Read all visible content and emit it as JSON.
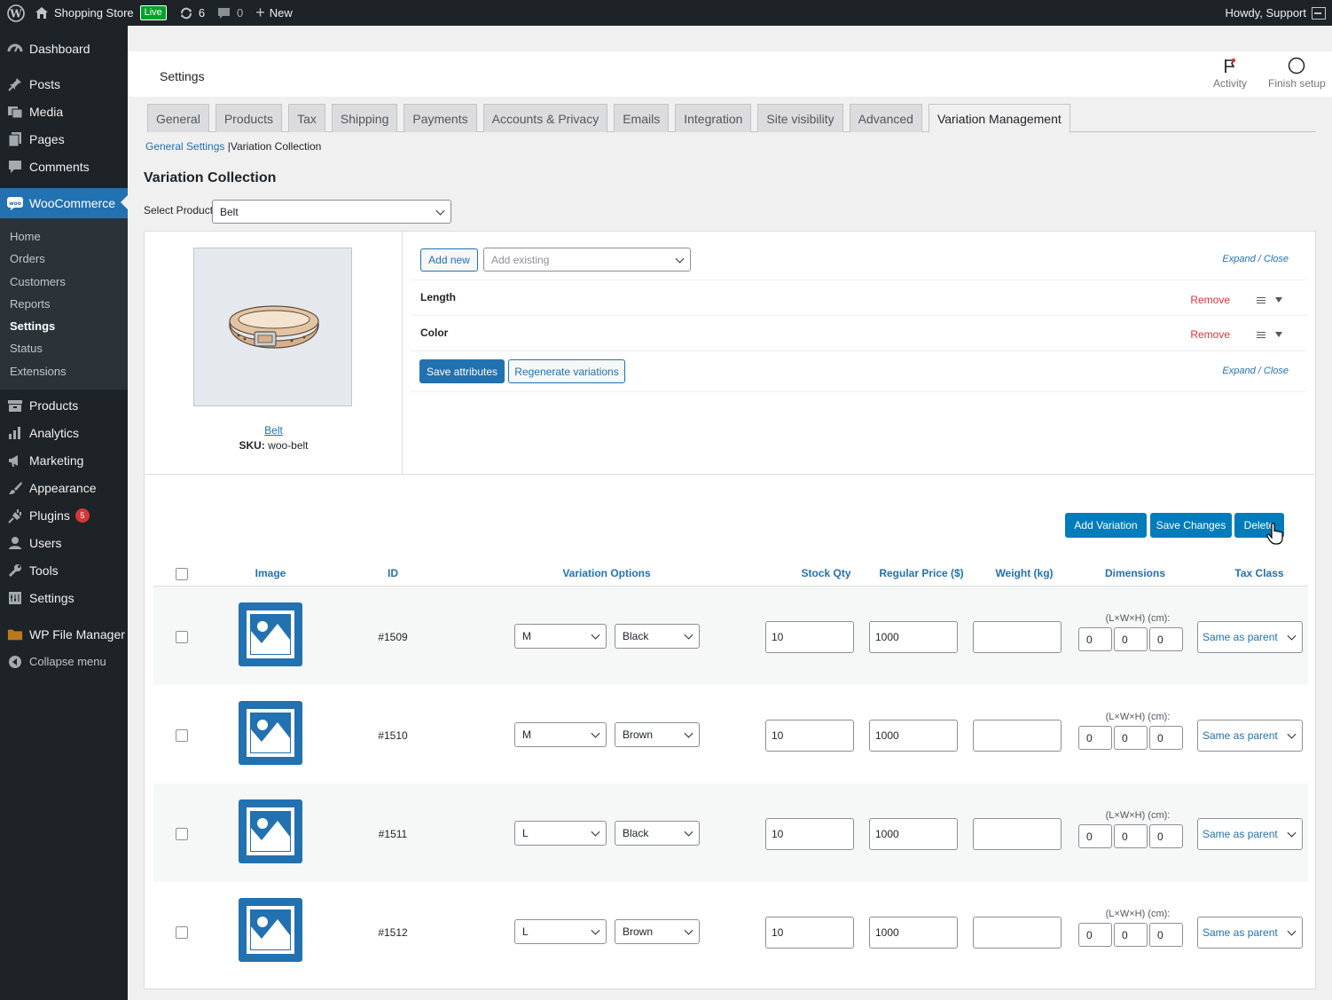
{
  "adminbar": {
    "site_name": "Shopping Store",
    "live_badge": "Live",
    "updates_count": "6",
    "comments_count": "0",
    "new_label": "New",
    "howdy": "Howdy, Support"
  },
  "sidebar": {
    "items_top": [
      {
        "label": "Dashboard",
        "icon": "dashboard-icon"
      },
      {
        "label": "Posts",
        "icon": "pin-icon"
      },
      {
        "label": "Media",
        "icon": "media-icon"
      },
      {
        "label": "Pages",
        "icon": "pages-icon"
      },
      {
        "label": "Comments",
        "icon": "comment-icon"
      }
    ],
    "woocommerce": "WooCommerce",
    "submenu": [
      "Home",
      "Orders",
      "Customers",
      "Reports",
      "Settings",
      "Status",
      "Extensions"
    ],
    "items_bottom": [
      {
        "label": "Products",
        "icon": "archive-icon"
      },
      {
        "label": "Analytics",
        "icon": "chart-icon"
      },
      {
        "label": "Marketing",
        "icon": "megaphone-icon"
      },
      {
        "label": "Appearance",
        "icon": "brush-icon"
      },
      {
        "label": "Plugins",
        "icon": "plug-icon"
      },
      {
        "label": "Users",
        "icon": "user-icon"
      },
      {
        "label": "Tools",
        "icon": "wrench-icon"
      },
      {
        "label": "Settings",
        "icon": "settings-icon"
      }
    ],
    "plugins_badge": "5",
    "file_manager": "WP File Manager",
    "collapse": "Collapse menu"
  },
  "header": {
    "title": "Settings",
    "activity": "Activity",
    "finish_setup": "Finish setup"
  },
  "tabs": [
    "General",
    "Products",
    "Tax",
    "Shipping",
    "Payments",
    "Accounts & Privacy",
    "Emails",
    "Integration",
    "Site visibility",
    "Advanced",
    "Variation Management"
  ],
  "breadcrumb": {
    "link": "General Settings",
    "separator": "|",
    "current": "Variation Collection"
  },
  "page_heading": "Variation Collection",
  "select_product": {
    "label": "Select Product",
    "value": "Belt"
  },
  "product": {
    "name": "Belt",
    "sku_label": "SKU:",
    "sku_value": "woo-belt"
  },
  "attributes": {
    "add_new": "Add new",
    "add_existing_placeholder": "Add existing",
    "expand": "Expand",
    "slash": "/",
    "close": "Close",
    "items": [
      "Length",
      "Color"
    ],
    "remove": "Remove",
    "save_attributes": "Save attributes",
    "regenerate": "Regenerate variations"
  },
  "actions": {
    "add_variation": "Add Variation",
    "save_changes": "Save Changes",
    "delete": "Delete"
  },
  "table": {
    "headers": [
      "Image",
      "ID",
      "Variation Options",
      "Stock Qty",
      "Regular Price ($)",
      "Weight (kg)",
      "Dimensions",
      "Tax Class"
    ],
    "dim_label": "(L×W×H) (cm):",
    "rows": [
      {
        "id": "#1509",
        "opt1": "M",
        "opt2": "Black",
        "stock": "10",
        "price": "1000",
        "weight": "",
        "l": "0",
        "w": "0",
        "h": "0",
        "tax": "Same as parent"
      },
      {
        "id": "#1510",
        "opt1": "M",
        "opt2": "Brown",
        "stock": "10",
        "price": "1000",
        "weight": "",
        "l": "0",
        "w": "0",
        "h": "0",
        "tax": "Same as parent"
      },
      {
        "id": "#1511",
        "opt1": "L",
        "opt2": "Black",
        "stock": "10",
        "price": "1000",
        "weight": "",
        "l": "0",
        "w": "0",
        "h": "0",
        "tax": "Same as parent"
      },
      {
        "id": "#1512",
        "opt1": "L",
        "opt2": "Brown",
        "stock": "10",
        "price": "1000",
        "weight": "",
        "l": "0",
        "w": "0",
        "h": "0",
        "tax": "Same as parent"
      }
    ]
  },
  "colors": {
    "admin_dark": "#1d2327",
    "accent": "#2271b1",
    "action_blue": "#007cba",
    "remove_red": "#d63638",
    "live_green": "#00a32a"
  }
}
